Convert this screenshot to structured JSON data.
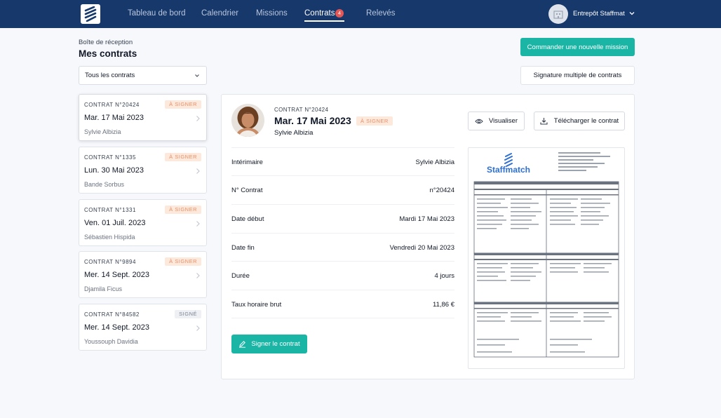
{
  "nav": {
    "items": [
      {
        "label": "Tableau de bord"
      },
      {
        "label": "Calendrier"
      },
      {
        "label": "Missions"
      },
      {
        "label": "Contrats",
        "badge": "4",
        "active": true
      },
      {
        "label": "Relevés"
      }
    ],
    "user_name": "Entrepôt Staffmatch"
  },
  "header": {
    "breadcrumb": "Boîte de réception",
    "title": "Mes contrats",
    "order_button": "Commander une nouvelle mission",
    "multi_sign_button": "Signature multiple de contrats",
    "filter_value": "Tous les contrats"
  },
  "contracts": [
    {
      "number": "CONTRAT N°20424",
      "status": "À SIGNER",
      "date": "Mar. 17 Mai 2023",
      "person": "Sylvie Albizia"
    },
    {
      "number": "CONTRAT N°1335",
      "status": "À SIGNER",
      "date": "Lun. 30 Mai 2023",
      "person": "Bande Sorbus"
    },
    {
      "number": "CONTRAT N°1331",
      "status": "À SIGNER",
      "date": "Ven. 01 Juil. 2023",
      "person": "Sébastien Hispida"
    },
    {
      "number": "CONTRAT N°9894",
      "status": "À SIGNER",
      "date": "Mer. 14 Sept. 2023",
      "person": "Djamila Ficus"
    },
    {
      "number": "CONTRAT N°84582",
      "status": "SIGNÉ",
      "date": "Mer. 14 Sept. 2023",
      "person": "Youssouph Davidia"
    }
  ],
  "detail": {
    "number": "CONTRAT N°20424",
    "date": "Mar. 17 Mai 2023",
    "status": "À SIGNER",
    "person": "Sylvie Albizia",
    "view_button": "Visualiser",
    "download_button": "Télécharger le contrat",
    "sign_button": "Signer le contrat",
    "fields": [
      {
        "label": "Intérimaire",
        "value": "Sylvie Albizia"
      },
      {
        "label": "N° Contrat",
        "value": "n°20424"
      },
      {
        "label": "Date début",
        "value": "Mardi 17 Mai 2023"
      },
      {
        "label": "Date fin",
        "value": "Vendredi 20 Mai 2023"
      },
      {
        "label": "Durée",
        "value": "4 jours"
      },
      {
        "label": "Taux horaire brut",
        "value": "11,86 €"
      }
    ],
    "preview_logo": "Staffmatch"
  },
  "colors": {
    "navbar": "#17386b",
    "accent": "#1bb5a5",
    "badge_to_sign_bg": "#fde8dc",
    "badge_to_sign_text": "#e5926a",
    "badge_signed_bg": "#eef0f4",
    "notification": "#e45757"
  },
  "icons": [
    "staffmatch-logo-icon",
    "building-icon",
    "chevron-down-icon",
    "chevron-right-icon",
    "eye-icon",
    "download-icon",
    "pen-icon"
  ]
}
